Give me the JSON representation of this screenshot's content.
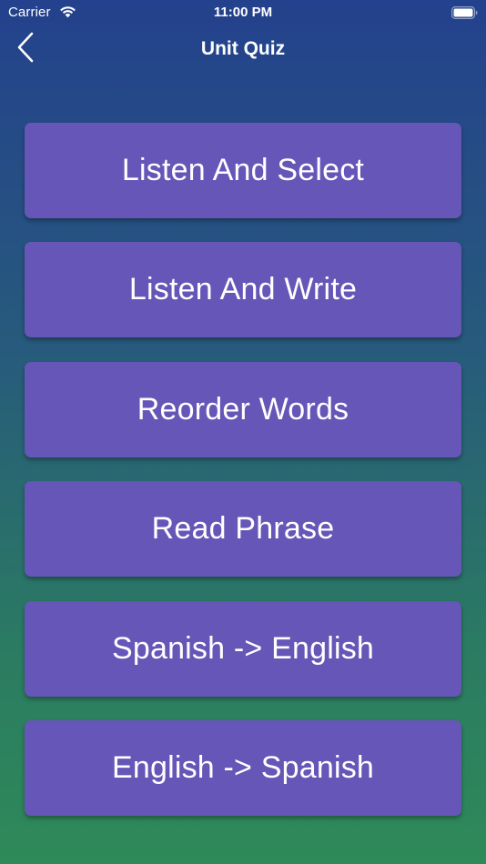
{
  "status_bar": {
    "carrier": "Carrier",
    "time": "11:00 PM",
    "wifi_icon": "wifi-icon",
    "battery_icon": "battery-icon"
  },
  "nav": {
    "title": "Unit Quiz",
    "back_icon": "chevron-left-icon"
  },
  "quiz_options": [
    {
      "label": "Listen And Select"
    },
    {
      "label": "Listen And Write"
    },
    {
      "label": "Reorder Words"
    },
    {
      "label": "Read Phrase"
    },
    {
      "label": "Spanish -> English"
    },
    {
      "label": "English -> Spanish"
    }
  ],
  "colors": {
    "background_top": "#24418d",
    "background_bottom": "#2e8a58",
    "button": "#6556b7",
    "text": "#ffffff"
  }
}
